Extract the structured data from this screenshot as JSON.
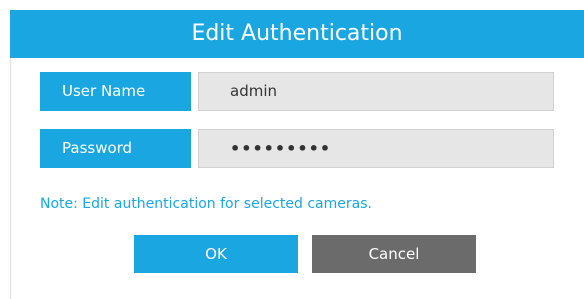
{
  "dialog": {
    "title": "Edit Authentication",
    "colors": {
      "accent": "#1aa6e0",
      "field_bg": "#e6e6e6",
      "cancel_bg": "#6b6b6b"
    }
  },
  "form": {
    "username_label": "User Name",
    "username_value": "admin",
    "password_label": "Password",
    "password_value": "•••••••••"
  },
  "note": "Note: Edit authentication for selected cameras.",
  "buttons": {
    "ok_label": "OK",
    "cancel_label": "Cancel"
  }
}
